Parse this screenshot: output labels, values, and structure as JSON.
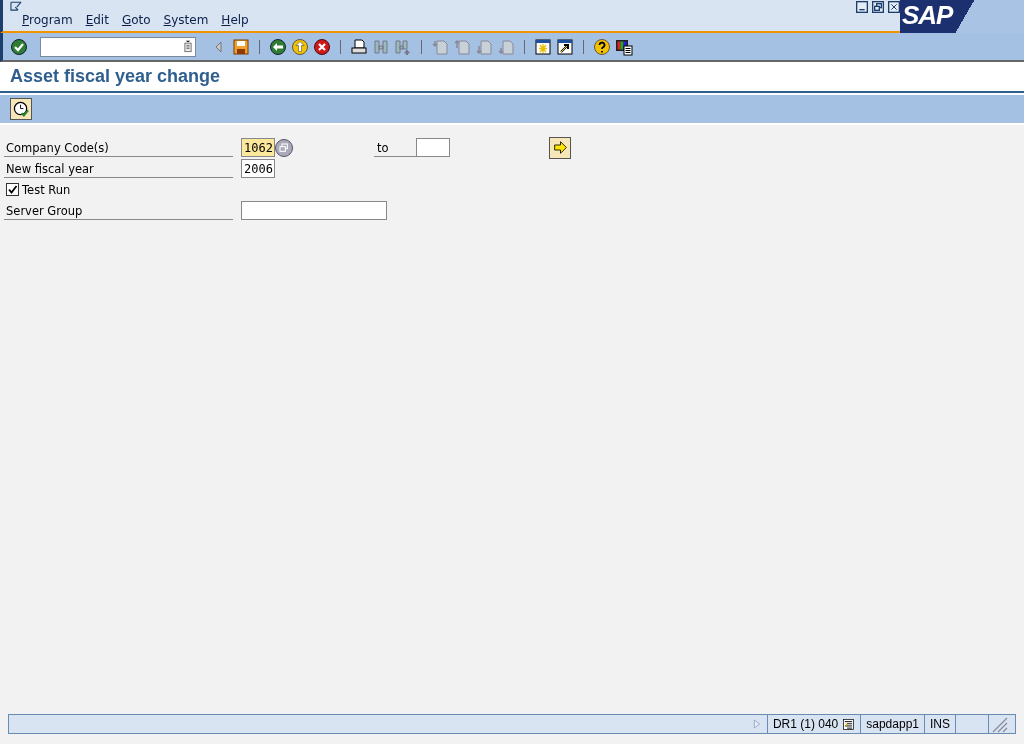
{
  "menu": [
    {
      "label": "Program"
    },
    {
      "label": "Edit"
    },
    {
      "label": "Goto"
    },
    {
      "label": "System"
    },
    {
      "label": "Help"
    }
  ],
  "logo": "SAP",
  "title": "Asset fiscal year change",
  "form": {
    "company_code": {
      "label": "Company Code(s)",
      "value": "1062",
      "to_label": "to"
    },
    "fiscal_year": {
      "label": "New fiscal year",
      "value": "2006"
    },
    "test_run": {
      "label": "Test Run",
      "checked": true
    },
    "server_group": {
      "label": "Server Group"
    }
  },
  "status_bar": {
    "system": "DR1 (1) 040",
    "server": "sapdapp1",
    "mode": "INS"
  }
}
